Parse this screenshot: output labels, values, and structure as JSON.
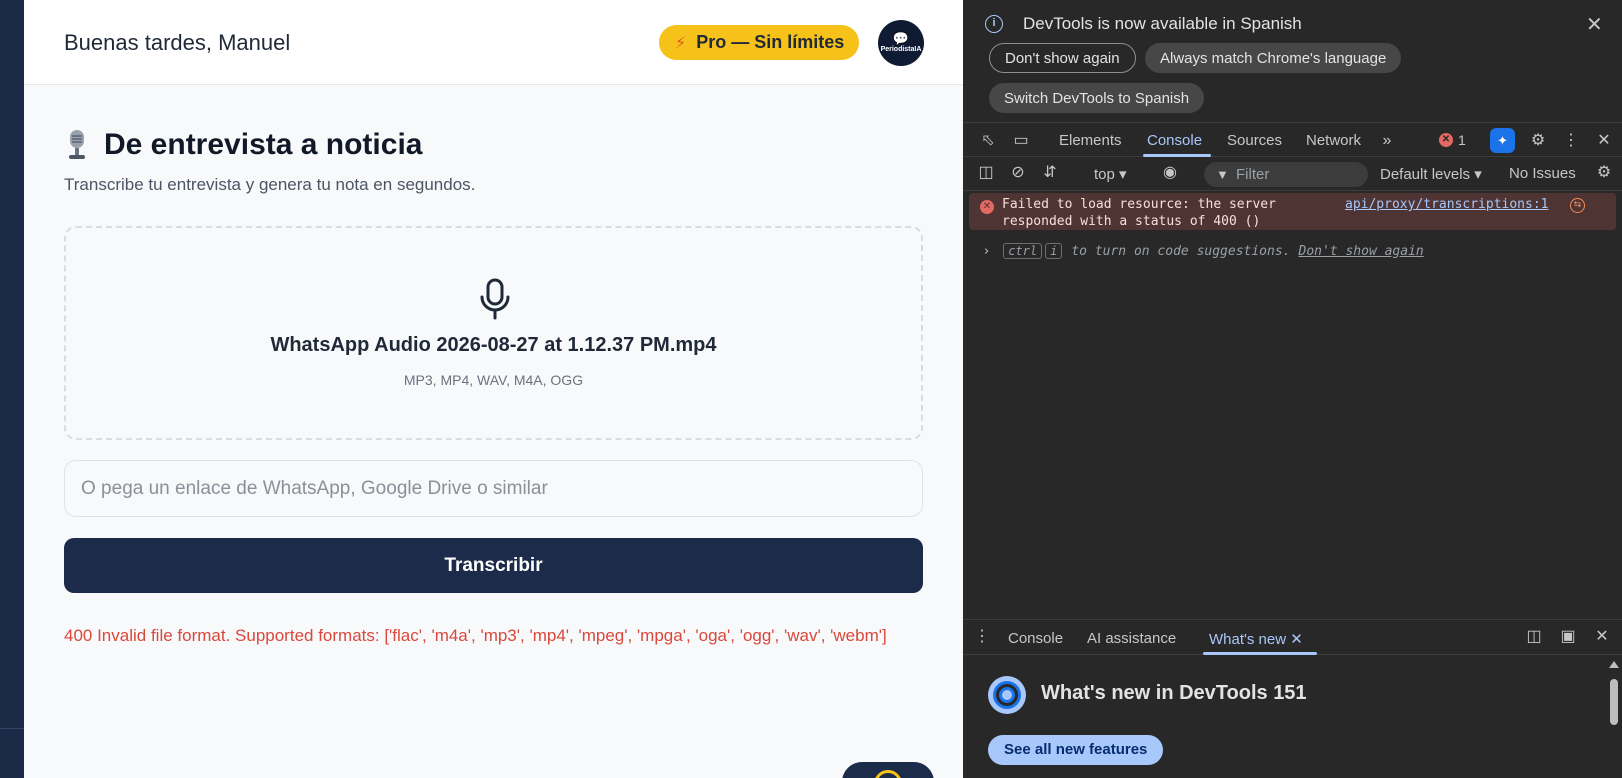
{
  "app": {
    "greeting": "Buenas tardes, Manuel",
    "pro_badge": "Pro — Sin límites",
    "avatar_brand": "PeriodistaIA",
    "title": "De entrevista a noticia",
    "subtitle": "Transcribe tu entrevista y genera tu nota en segundos.",
    "dropzone": {
      "file_name": "WhatsApp Audio 2026-08-27 at 1.12.37 PM.mp4",
      "formats": "MP3, MP4, WAV, M4A, OGG"
    },
    "link_input": {
      "value": "",
      "placeholder": "O pega un enlace de WhatsApp, Google Drive o similar"
    },
    "transcribe_label": "Transcribir",
    "error": "400 Invalid file format. Supported formats: ['flac', 'm4a', 'mp3', 'mp4', 'mpeg', 'mpga', 'oga', 'ogg', 'wav', 'webm']",
    "colors": {
      "navy": "#1c2b4a",
      "accent": "#f6c21a",
      "error": "#d9483b"
    }
  },
  "devtools": {
    "notice": {
      "message": "DevTools is now available in Spanish",
      "dont_show": "Don't show again",
      "always_match": "Always match Chrome's language",
      "switch": "Switch DevTools to Spanish"
    },
    "tabs": [
      "Elements",
      "Console",
      "Sources",
      "Network"
    ],
    "active_tab": "Console",
    "error_count": "1",
    "console_toolbar": {
      "context": "top",
      "filter_placeholder": "Filter",
      "levels": "Default levels",
      "issues": "No Issues"
    },
    "console_error": {
      "line1": "Failed to load resource: the server",
      "line2": "responded with a status of 400 ()",
      "source": "api/proxy/transcriptions:1"
    },
    "hint": {
      "key1": "ctrl",
      "key2": "i",
      "text": "to turn on code suggestions.",
      "dismiss": "Don't show again"
    },
    "drawer": {
      "tabs": [
        "Console",
        "AI assistance",
        "What's new"
      ],
      "active_tab": "What's new",
      "whats_new_title": "What's new in DevTools 151",
      "see_all": "See all new features"
    }
  }
}
